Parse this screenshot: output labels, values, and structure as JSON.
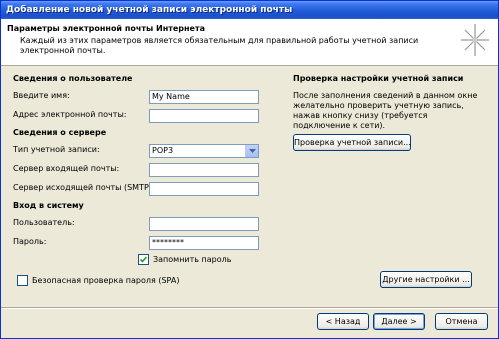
{
  "window": {
    "title": "Добавление новой учетной записи электронной почты"
  },
  "header": {
    "title": "Параметры электронной почты Интернета",
    "description": "Каждый из этих параметров является обязательным для правильной работы учетной записи электронной почты.",
    "icon": "sparkle-wizard-icon"
  },
  "user_info": {
    "section_label": "Сведения о пользователе",
    "name_label": "Введите имя:",
    "name_value": "My Name",
    "email_label": "Адрес электронной почты:",
    "email_value": ""
  },
  "server_info": {
    "section_label": "Сведения о сервере",
    "account_type_label": "Тип учетной записи:",
    "account_type_value": "POP3",
    "incoming_label": "Сервер входящей почты:",
    "incoming_value": "",
    "outgoing_label": "Сервер исходящей почты (SMTP):",
    "outgoing_value": ""
  },
  "login": {
    "section_label": "Вход в систему",
    "user_label": "Пользователь:",
    "user_value": "",
    "password_label": "Пароль:",
    "password_value": "********",
    "remember_label": "Запомнить пароль",
    "remember_checked": true,
    "spa_label": "Безопасная проверка пароля (SPA)",
    "spa_checked": false
  },
  "test_settings": {
    "section_label": "Проверка настройки учетной записи",
    "description": "После заполнения сведений в данном окне желательно проверить учетную запись, нажав кнопку снизу (требуется подключение к сети).",
    "test_button": "Проверка учетной записи..."
  },
  "buttons": {
    "more_settings": "Другие настройки ...",
    "back": "< Назад",
    "next": "Далее >",
    "cancel": "Отмена"
  }
}
